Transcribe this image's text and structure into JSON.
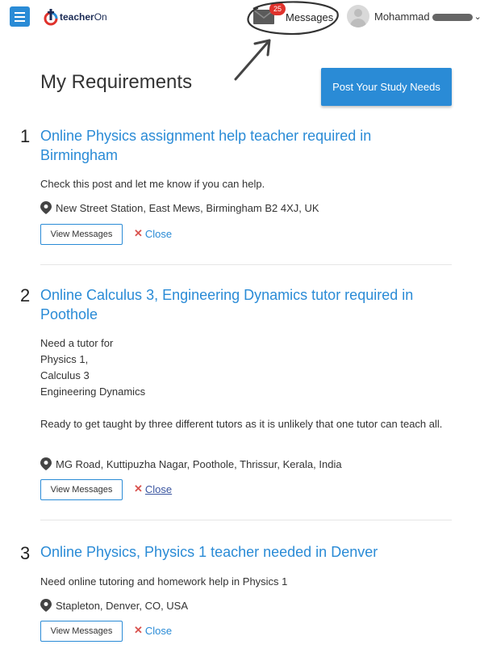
{
  "header": {
    "logo_teacher": "teacher",
    "logo_on": "On",
    "messages_label": "Messages",
    "messages_count": "25",
    "user_name": "Mohammad",
    "chevron": "⌄"
  },
  "page": {
    "title": "My Requirements",
    "post_button": "Post Your Study Needs"
  },
  "requirements": [
    {
      "number": "1",
      "title": "Online Physics assignment help teacher required in Birmingham",
      "description": "Check this post and let me know if you can help.",
      "location": "New Street Station, East Mews, Birmingham B2 4XJ, UK",
      "view_label": "View Messages",
      "close_label": "Close"
    },
    {
      "number": "2",
      "title": "Online Calculus 3, Engineering Dynamics tutor required in Poothole",
      "description": "Need a tutor for\nPhysics 1,\nCalculus 3\nEngineering Dynamics\n\nReady to get taught by three different tutors as it is unlikely that one tutor can teach all.",
      "location": "MG Road, Kuttipuzha Nagar, Poothole, Thrissur, Kerala, India",
      "view_label": "View Messages",
      "close_label": "Close"
    },
    {
      "number": "3",
      "title": "Online Physics, Physics 1 teacher needed in Denver",
      "description": "Need online tutoring and homework help in Physics 1",
      "location": "Stapleton, Denver, CO, USA",
      "view_label": "View Messages",
      "close_label": "Close"
    }
  ],
  "icons": {
    "menu": "hamburger-menu-icon",
    "messages": "envelope-icon",
    "location": "map-pin-icon",
    "close": "close-x-icon",
    "avatar": "user-avatar-icon"
  },
  "colors": {
    "accent": "#2a8bd6",
    "badge": "#e0322c",
    "close_x": "#d9534f"
  }
}
